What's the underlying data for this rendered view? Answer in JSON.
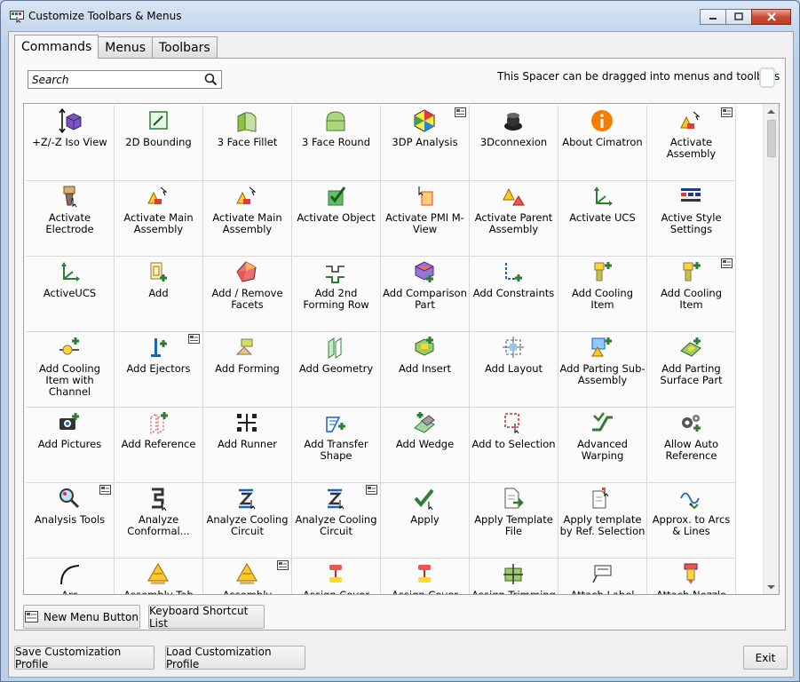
{
  "window": {
    "title": "Customize Toolbars & Menus"
  },
  "tabs": [
    {
      "label": "Commands",
      "active": true
    },
    {
      "label": "Menus",
      "active": false
    },
    {
      "label": "Toolbars",
      "active": false
    }
  ],
  "search": {
    "placeholder": "Search"
  },
  "spacer_hint": "This Spacer can be dragged into menus and toolbars",
  "commands": [
    {
      "label": "+Z/-Z Iso View",
      "icon": "iso-view-icon",
      "submenu": false
    },
    {
      "label": "2D Bounding",
      "icon": "bounding-icon",
      "submenu": false
    },
    {
      "label": "3 Face Fillet",
      "icon": "face-fillet-icon",
      "submenu": false
    },
    {
      "label": "3 Face Round",
      "icon": "face-round-icon",
      "submenu": false
    },
    {
      "label": "3DP Analysis",
      "icon": "dp-analysis-icon",
      "submenu": true
    },
    {
      "label": "3Dconnexion",
      "icon": "connexion-icon",
      "submenu": false
    },
    {
      "label": "About Cimatron",
      "icon": "info-icon",
      "submenu": false
    },
    {
      "label": "Activate Assembly",
      "icon": "activate-assembly-icon",
      "submenu": true
    },
    {
      "label": "Activate Electrode",
      "icon": "electrode-icon",
      "submenu": false
    },
    {
      "label": "Activate Main Assembly",
      "icon": "activate-assembly-icon",
      "submenu": false
    },
    {
      "label": "Activate Main Assembly",
      "icon": "activate-assembly-icon",
      "submenu": false
    },
    {
      "label": "Activate Object",
      "icon": "object-icon",
      "submenu": false
    },
    {
      "label": "Activate PMI M-View",
      "icon": "pmi-icon",
      "submenu": false
    },
    {
      "label": "Activate Parent Assembly",
      "icon": "parent-assembly-icon",
      "submenu": false
    },
    {
      "label": "Activate UCS",
      "icon": "ucs-icon",
      "submenu": false
    },
    {
      "label": "Active Style Settings",
      "icon": "style-settings-icon",
      "submenu": false
    },
    {
      "label": "ActiveUCS",
      "icon": "ucs-icon",
      "submenu": false
    },
    {
      "label": "Add",
      "icon": "add-icon",
      "submenu": false
    },
    {
      "label": "Add / Remove Facets",
      "icon": "facets-icon",
      "submenu": false
    },
    {
      "label": "Add 2nd Forming Row",
      "icon": "forming-row-icon",
      "submenu": false
    },
    {
      "label": "Add Comparison Part",
      "icon": "comparison-icon",
      "submenu": false
    },
    {
      "label": "Add Constraints",
      "icon": "constraints-icon",
      "submenu": false
    },
    {
      "label": "Add Cooling Item",
      "icon": "cooling-icon",
      "submenu": false
    },
    {
      "label": "Add Cooling Item",
      "icon": "cooling-icon",
      "submenu": true
    },
    {
      "label": "Add Cooling Item with Channel",
      "icon": "cooling-channel-icon",
      "submenu": false
    },
    {
      "label": "Add Ejectors",
      "icon": "ejector-icon",
      "submenu": true
    },
    {
      "label": "Add Forming",
      "icon": "forming-icon",
      "submenu": false
    },
    {
      "label": "Add Geometry",
      "icon": "geometry-icon",
      "submenu": false
    },
    {
      "label": "Add Insert",
      "icon": "insert-icon",
      "submenu": false
    },
    {
      "label": "Add Layout",
      "icon": "layout-icon",
      "submenu": false
    },
    {
      "label": "Add Parting Sub-Assembly",
      "icon": "parting-sub-icon",
      "submenu": false
    },
    {
      "label": "Add Parting Surface Part",
      "icon": "parting-surface-icon",
      "submenu": false
    },
    {
      "label": "Add Pictures",
      "icon": "camera-icon",
      "submenu": false
    },
    {
      "label": "Add Reference",
      "icon": "reference-icon",
      "submenu": false
    },
    {
      "label": "Add Runner",
      "icon": "runner-icon",
      "submenu": false
    },
    {
      "label": "Add Transfer Shape",
      "icon": "transfer-icon",
      "submenu": false
    },
    {
      "label": "Add Wedge",
      "icon": "wedge-icon",
      "submenu": false
    },
    {
      "label": "Add to Selection",
      "icon": "selection-icon",
      "submenu": false
    },
    {
      "label": "Advanced Warping",
      "icon": "warping-icon",
      "submenu": false
    },
    {
      "label": "Allow Auto Reference",
      "icon": "auto-reference-icon",
      "submenu": false
    },
    {
      "label": "Analysis Tools",
      "icon": "analysis-icon",
      "submenu": true
    },
    {
      "label": "Analyze Conformal...",
      "icon": "conformal-icon",
      "submenu": false
    },
    {
      "label": "Analyze Cooling Circuit",
      "icon": "cooling-circuit-icon",
      "submenu": false
    },
    {
      "label": "Analyze Cooling Circuit",
      "icon": "cooling-circuit-icon",
      "submenu": true
    },
    {
      "label": "Apply",
      "icon": "apply-icon",
      "submenu": false
    },
    {
      "label": "Apply Template File",
      "icon": "template-icon",
      "submenu": false
    },
    {
      "label": "Apply template by Ref. Selection",
      "icon": "template-ref-icon",
      "submenu": false
    },
    {
      "label": "Approx. to Arcs & Lines",
      "icon": "approx-icon",
      "submenu": false
    },
    {
      "label": "Arc",
      "icon": "arc-icon",
      "submenu": false
    },
    {
      "label": "Assembly Tab",
      "icon": "assembly-tab-icon",
      "submenu": false
    },
    {
      "label": "Assembly",
      "icon": "assembly-tab-icon",
      "submenu": true
    },
    {
      "label": "Assign Cover",
      "icon": "assign-icon",
      "submenu": false
    },
    {
      "label": "Assign Cover",
      "icon": "assign-icon",
      "submenu": false
    },
    {
      "label": "Assign Trimming",
      "icon": "trimming-icon",
      "submenu": false
    },
    {
      "label": "Attach Label",
      "icon": "label-icon",
      "submenu": false
    },
    {
      "label": "Attach Nozzle",
      "icon": "nozzle-icon",
      "submenu": false
    }
  ],
  "buttons": {
    "new_menu": "New Menu Button",
    "keyboard": "Keyboard Shortcut List",
    "save_profile": "Save Customization Profile",
    "load_profile": "Load Customization Profile",
    "exit": "Exit"
  }
}
